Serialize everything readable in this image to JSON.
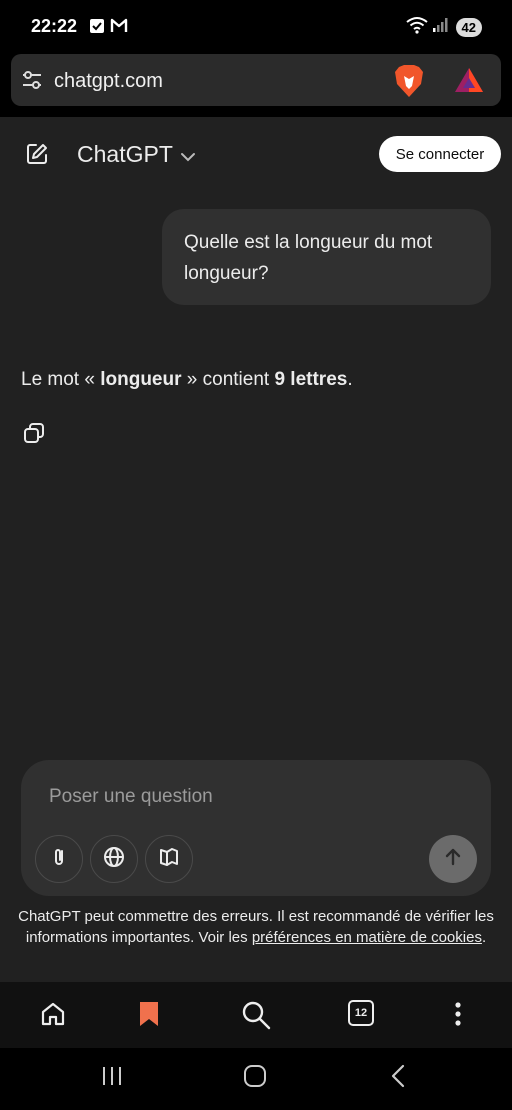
{
  "status_bar": {
    "time": "22:22",
    "battery": "42",
    "icons": [
      "check-notification-icon",
      "gmail-icon",
      "wifi-icon",
      "signal-icon"
    ]
  },
  "browser": {
    "url": "chatgpt.com",
    "icons": [
      "tune-icon",
      "brave-lion-icon",
      "bat-rewards-icon"
    ]
  },
  "header": {
    "title": "ChatGPT",
    "login_label": "Se connecter"
  },
  "conversation": {
    "user_message": "Quelle est la longueur du mot longueur?",
    "assistant": {
      "prefix": "Le mot « ",
      "word": "longueur",
      "middle": " » contient ",
      "count": "9 lettres",
      "suffix": "."
    }
  },
  "composer": {
    "placeholder": "Poser une question",
    "tools": [
      "attach-icon",
      "globe-icon",
      "book-icon"
    ]
  },
  "disclaimer": {
    "text": "ChatGPT peut commettre des erreurs. Il est recommandé de vérifier les informations importantes. Voir les ",
    "link": "préférences en matière de cookies",
    "end": "."
  },
  "bottom_nav": {
    "tab_count": "12",
    "accent": "#f0714d"
  },
  "colors": {
    "background": "#212121",
    "bubble": "#303030",
    "text": "#ececec"
  }
}
